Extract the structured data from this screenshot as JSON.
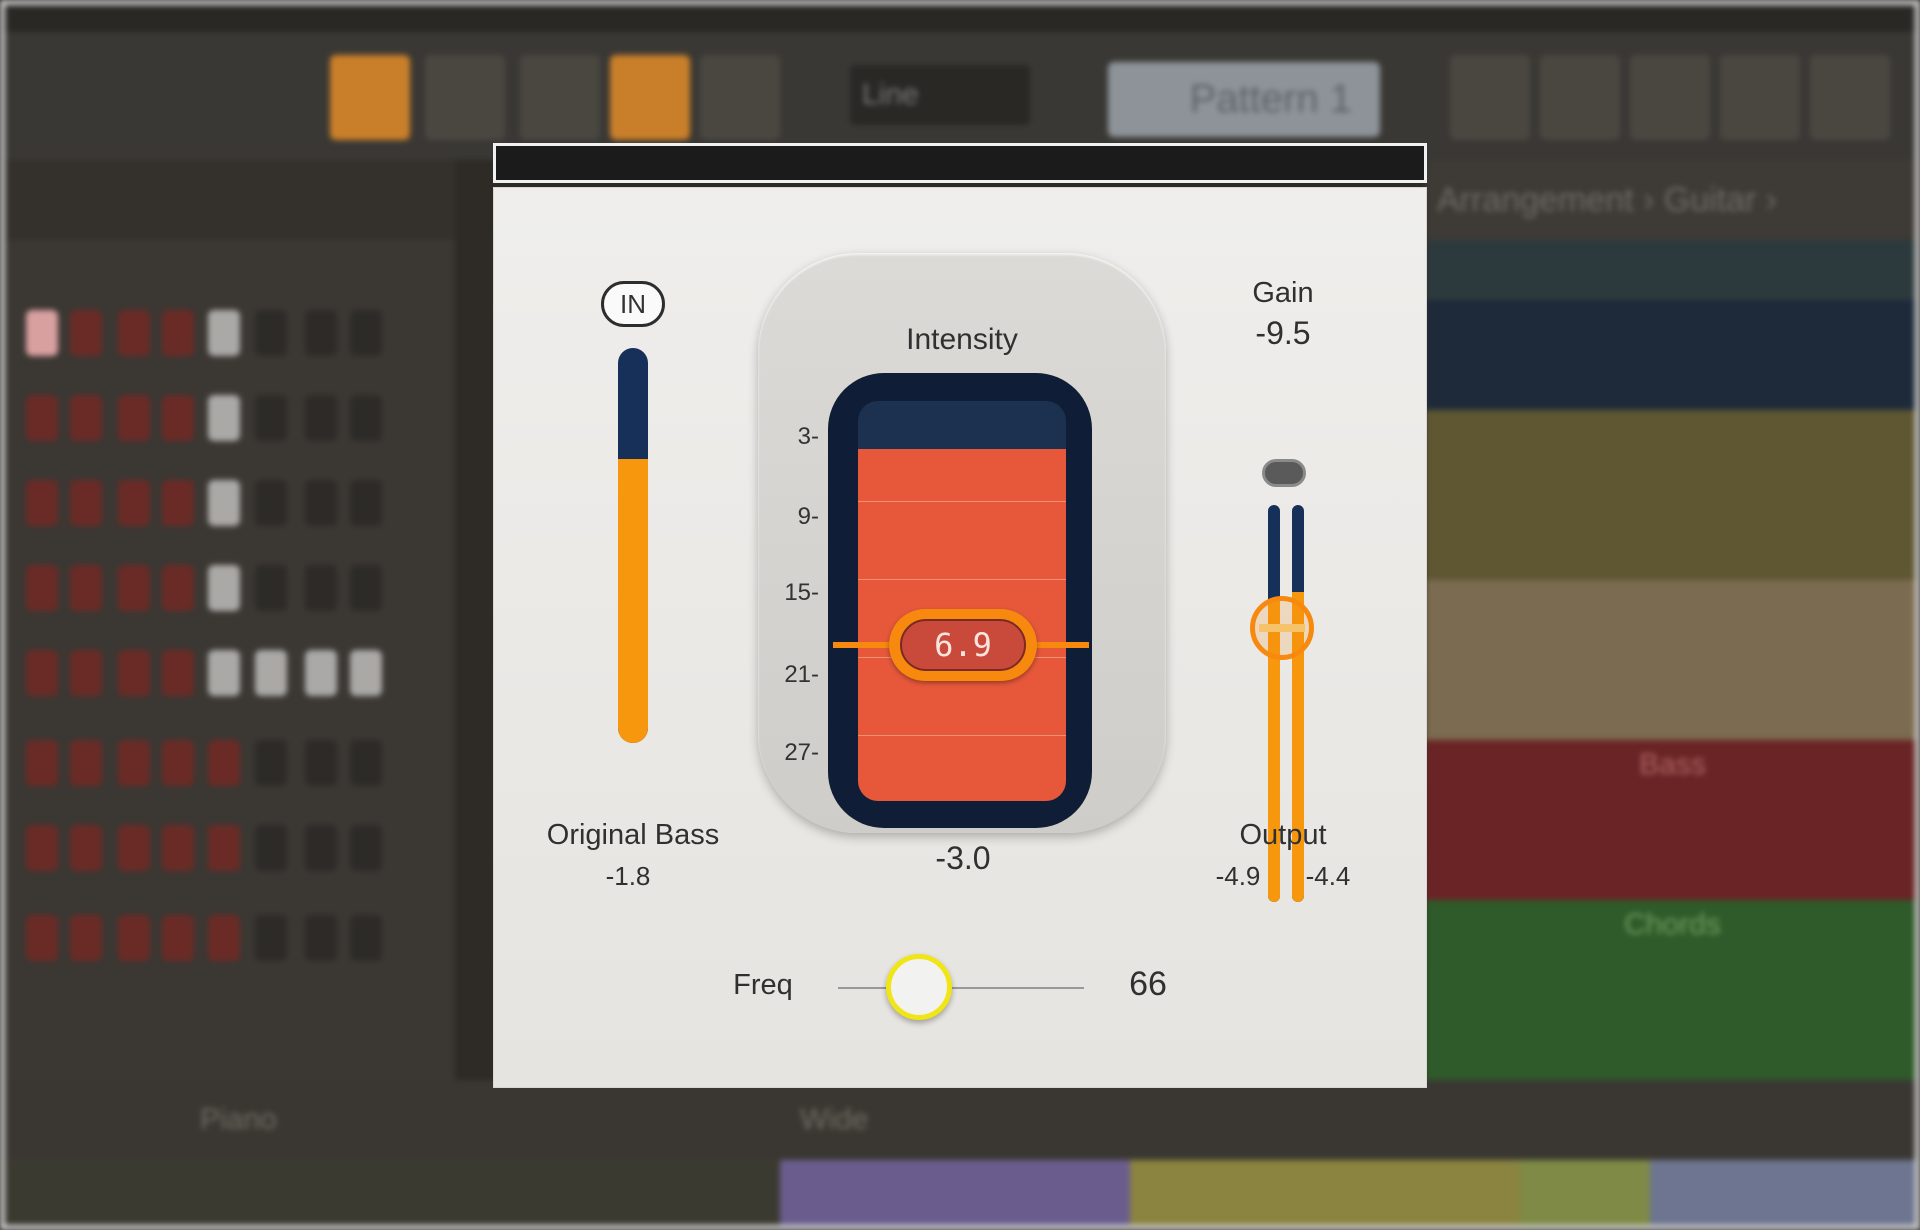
{
  "background_app": {
    "mode_select": "Line",
    "pattern": "Pattern 1",
    "breadcrumb": "Arrangement › Guitar ›",
    "tracks": [
      "Bass",
      "Chords"
    ],
    "bottom_labels": [
      "Piano",
      "Wide"
    ]
  },
  "plugin": {
    "in_button": "IN",
    "original_bass": {
      "label": "Original Bass",
      "value": "-1.8",
      "level": 0.72
    },
    "intensity": {
      "title": "Intensity",
      "scale": [
        "3-",
        "9-",
        "15-",
        "21-",
        "27-"
      ],
      "threshold": "6.9",
      "value": "-3.0",
      "fill_level": 0.88
    },
    "gain": {
      "label": "Gain",
      "value": "-9.5"
    },
    "output": {
      "label": "Output",
      "left": "-4.9",
      "right": "-4.4",
      "left_level": 0.76,
      "right_level": 0.78
    },
    "freq": {
      "label": "Freq",
      "value": "66",
      "position": 0.33
    }
  },
  "colors": {
    "accent_orange": "#f7890f",
    "meter_fill": "#f6970e",
    "meter_empty": "#17305a",
    "intensity_fill": "#e7583b",
    "freq_ring": "#f0e515"
  }
}
